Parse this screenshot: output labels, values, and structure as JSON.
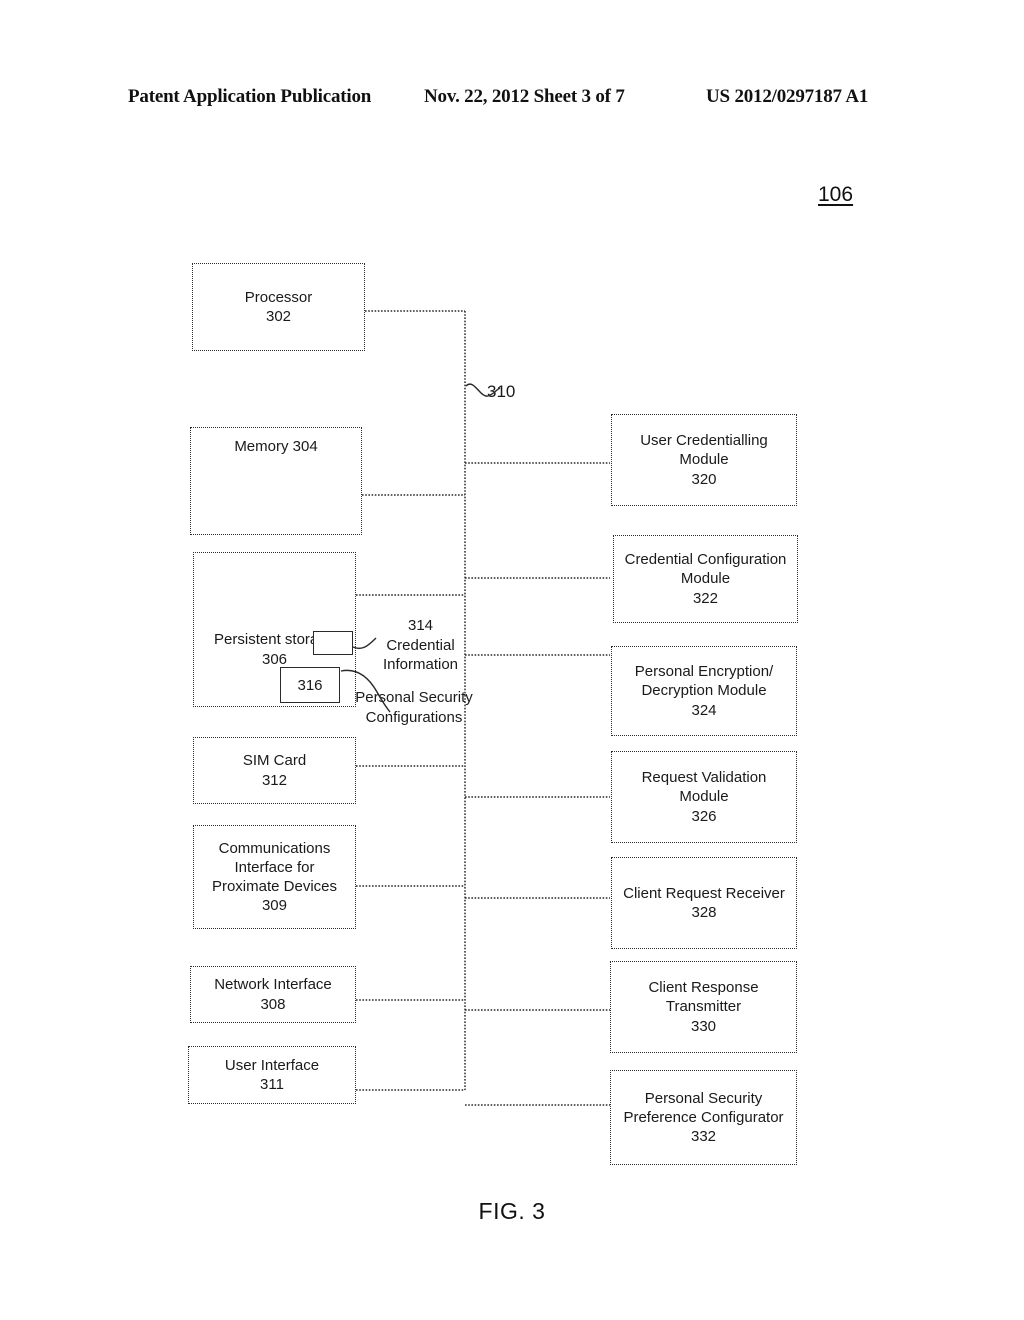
{
  "header": {
    "publication": "Patent Application Publication",
    "date_sheet": "Nov. 22, 2012  Sheet 3 of 7",
    "patent_number": "US 2012/0297187 A1"
  },
  "figure": {
    "reference_numeral": "106",
    "caption": "FIG. 3"
  },
  "bus": {
    "label": "310"
  },
  "left_column": {
    "processor": "Processor\n302",
    "memory": "Memory 304",
    "persistent_storage": "Persistent storage\n306",
    "sim_card": "SIM Card\n312",
    "communications_interface": "Communications\nInterface for\nProximate Devices\n309",
    "network_interface": "Network Interface\n308",
    "user_interface": "User Interface\n311"
  },
  "storage_internals": {
    "credential_box_label": "",
    "credential_annotation": "314\nCredential\nInformation",
    "security_box_label": "316",
    "security_annotation": "Personal Security\nConfigurations"
  },
  "right_column": {
    "modules": [
      {
        "label": "User Credentialling\nModule\n320"
      },
      {
        "label": "Credential Configuration\nModule\n322"
      },
      {
        "label": "Personal Encryption/\nDecryption Module\n324"
      },
      {
        "label": "Request Validation\nModule\n326"
      },
      {
        "label": "Client Request Receiver\n328"
      },
      {
        "label": "Client Response\nTransmitter\n330"
      },
      {
        "label": "Personal Security\nPreference Configurator\n332"
      }
    ]
  }
}
